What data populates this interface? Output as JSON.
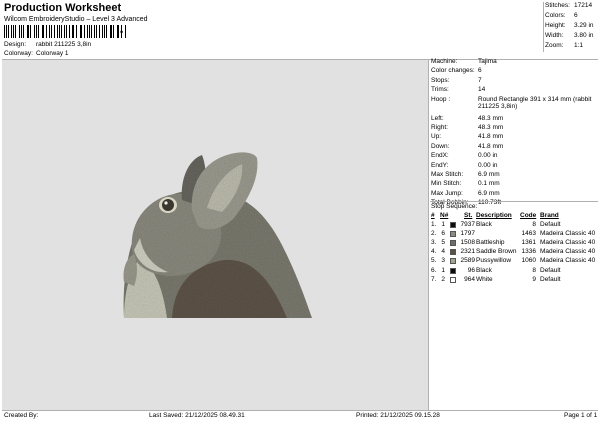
{
  "header": {
    "title": "Production Worksheet",
    "subtitle": "Wilcom EmbroideryStudio – Level 3 Advanced",
    "barcode_text": "*"
  },
  "meta": {
    "design_label": "Design:",
    "design_value": "rabbit 211225 3,8in",
    "colorway_label": "Colorway:",
    "colorway_value": "Colorway 1"
  },
  "stats": [
    {
      "label": "Stitches:",
      "value": "17214"
    },
    {
      "label": "Colors:",
      "value": "6"
    },
    {
      "label": "Height:",
      "value": "3.29 in"
    },
    {
      "label": "Width:",
      "value": "3.80 in"
    },
    {
      "label": "Zoom:",
      "value": "1:1"
    }
  ],
  "info": {
    "machine": {
      "label": "Machine:",
      "value": "Tajima"
    },
    "color_changes": {
      "label": "Color changes:",
      "value": "6"
    },
    "stops": {
      "label": "Stops:",
      "value": "7"
    },
    "trims": {
      "label": "Trims:",
      "value": "14"
    },
    "hoop": {
      "label": "Hoop :",
      "value": "Round Rectangle 391 x 314 mm (rabbit 211225 3,8in)"
    },
    "left": {
      "label": "Left:",
      "value": "48.3 mm"
    },
    "right": {
      "label": "Right:",
      "value": "48.3 mm"
    },
    "up": {
      "label": "Up:",
      "value": "41.8 mm"
    },
    "down": {
      "label": "Down:",
      "value": "41.8 mm"
    },
    "endx": {
      "label": "EndX:",
      "value": "0.00 in"
    },
    "endy": {
      "label": "EndY:",
      "value": "0.00 in"
    },
    "max_stitch": {
      "label": "Max Stitch:",
      "value": "6.9 mm"
    },
    "min_stitch": {
      "label": "Min Stitch:",
      "value": "0.1 mm"
    },
    "max_jump": {
      "label": "Max Jump:",
      "value": "6.9 mm"
    },
    "total_bobbin": {
      "label": "Total Bobbin:",
      "value": "110.73ft"
    }
  },
  "sequence": {
    "title": "Stop Sequence:",
    "headers": {
      "num": "#",
      "n": "N#",
      "st": "St.",
      "desc": "Description",
      "code": "Code",
      "brand": "Brand"
    },
    "rows": [
      {
        "num": "1.",
        "n": "1",
        "color": "#0c0c0c",
        "st": "7937",
        "desc": "Black",
        "code": "8",
        "brand": "Default"
      },
      {
        "num": "2.",
        "n": "6",
        "color": "#8a8a80",
        "st": "1797",
        "desc": "",
        "code": "1463",
        "brand": "Madeira Classic 40"
      },
      {
        "num": "3.",
        "n": "5",
        "color": "#6e6c66",
        "st": "1508",
        "desc": "Battleship",
        "code": "1361",
        "brand": "Madeira Classic 40"
      },
      {
        "num": "4.",
        "n": "4",
        "color": "#5a4f44",
        "st": "2321",
        "desc": "Saddle Brown",
        "code": "1336",
        "brand": "Madeira Classic 40"
      },
      {
        "num": "5.",
        "n": "3",
        "color": "#a5a590",
        "st": "2589",
        "desc": "Pussywillow",
        "code": "1060",
        "brand": "Madeira Classic 40"
      },
      {
        "num": "6.",
        "n": "1",
        "color": "#0c0c0c",
        "st": "96",
        "desc": "Black",
        "code": "8",
        "brand": "Default"
      },
      {
        "num": "7.",
        "n": "2",
        "color": "#ffffff",
        "st": "964",
        "desc": "White",
        "code": "9",
        "brand": "Default"
      }
    ]
  },
  "footer": {
    "created_by": "Created By:",
    "last_saved": "Last Saved: 21/12/2025 08.49.31",
    "printed": "Printed: 21/12/2025 09.15.28",
    "page": "Page 1 of 1"
  }
}
